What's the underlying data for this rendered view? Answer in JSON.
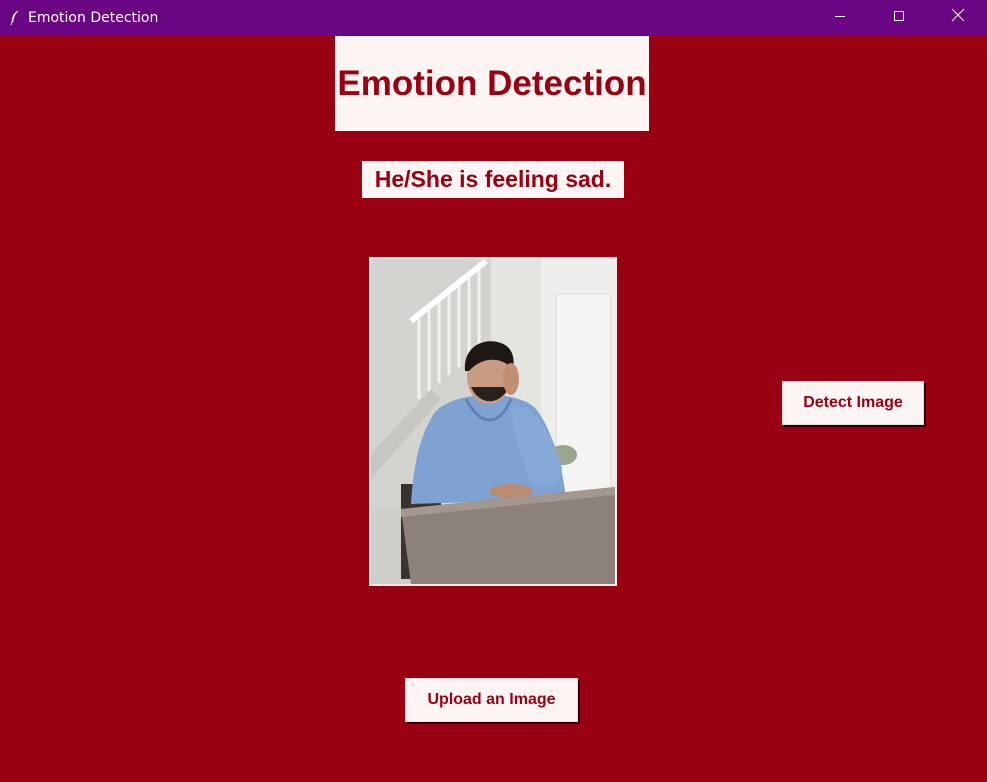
{
  "window": {
    "title": "Emotion Detection",
    "icons": {
      "app": "feather-icon",
      "minimize": "minimize-icon",
      "maximize": "maximize-icon",
      "close": "close-icon"
    }
  },
  "app": {
    "heading": "Emotion Detection",
    "result_text": "He/She is feeling sad.",
    "photo_subject": "man in blue hoodie sitting at table, head resting on hand",
    "detect_button_label": "Detect Image",
    "upload_button_label": "Upload an Image"
  },
  "colors": {
    "background": "#990011",
    "titlebar": "#6a0684",
    "label_background": "#fdf5f3",
    "accent_text": "#990011"
  }
}
